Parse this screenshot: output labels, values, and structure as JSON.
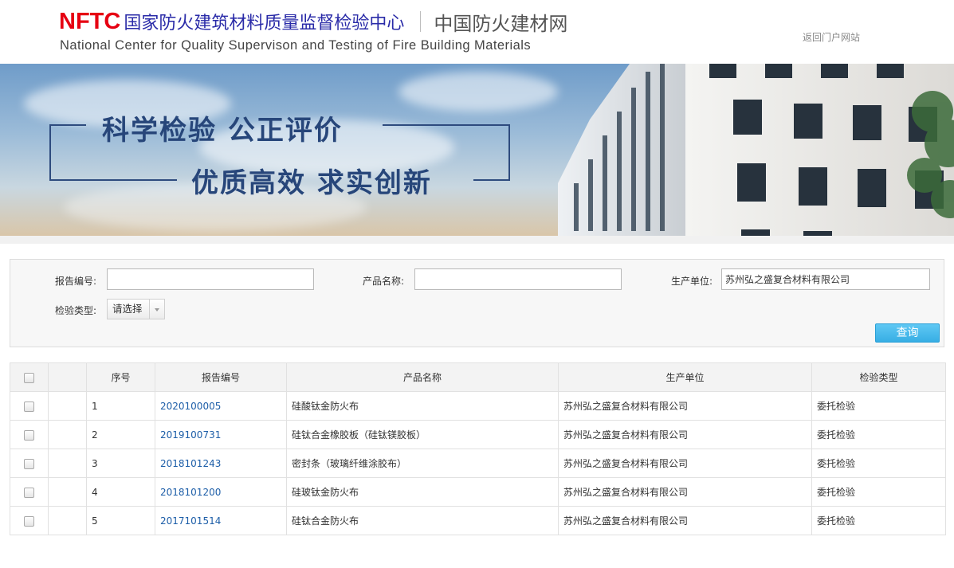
{
  "header": {
    "logo_abbr": "NFTC",
    "org_name_cn": "国家防火建筑材料质量监督检验中心",
    "site_name": "中国防火建材网",
    "org_name_en": "National Center for Quality Supervison and Testing of Fire Building Materials",
    "back_link": "返回门户网站"
  },
  "banner": {
    "slogan_1": "科学检验  公正评价",
    "slogan_2": "优质高效  求实创新"
  },
  "search": {
    "report_no_label": "报告编号:",
    "report_no_value": "",
    "product_name_label": "产品名称:",
    "product_name_value": "",
    "manufacturer_label": "生产单位:",
    "manufacturer_value": "苏州弘之盛复合材料有限公司",
    "inspection_type_label": "检验类型:",
    "inspection_type_value": "请选择",
    "query_button": "查询"
  },
  "table": {
    "headers": [
      "序号",
      "报告编号",
      "产品名称",
      "生产单位",
      "检验类型"
    ],
    "rows": [
      {
        "no": "1",
        "report_no": "2020100005",
        "product": "硅酸钛金防火布",
        "manufacturer": "苏州弘之盛复合材料有限公司",
        "type": "委托检验"
      },
      {
        "no": "2",
        "report_no": "2019100731",
        "product": "硅钛合金橡胶板（硅钛镁胶板）",
        "manufacturer": "苏州弘之盛复合材料有限公司",
        "type": "委托检验"
      },
      {
        "no": "3",
        "report_no": "2018101243",
        "product": "密封条（玻璃纤维涂胶布）",
        "manufacturer": "苏州弘之盛复合材料有限公司",
        "type": "委托检验"
      },
      {
        "no": "4",
        "report_no": "2018101200",
        "product": "硅玻钛金防火布",
        "manufacturer": "苏州弘之盛复合材料有限公司",
        "type": "委托检验"
      },
      {
        "no": "5",
        "report_no": "2017101514",
        "product": "硅钛合金防火布",
        "manufacturer": "苏州弘之盛复合材料有限公司",
        "type": "委托检验"
      }
    ]
  },
  "colors": {
    "brand_red": "#e60012",
    "brand_blue": "#2a2ba8",
    "link_blue": "#1d5ea8",
    "button_blue": "#37aee4"
  }
}
